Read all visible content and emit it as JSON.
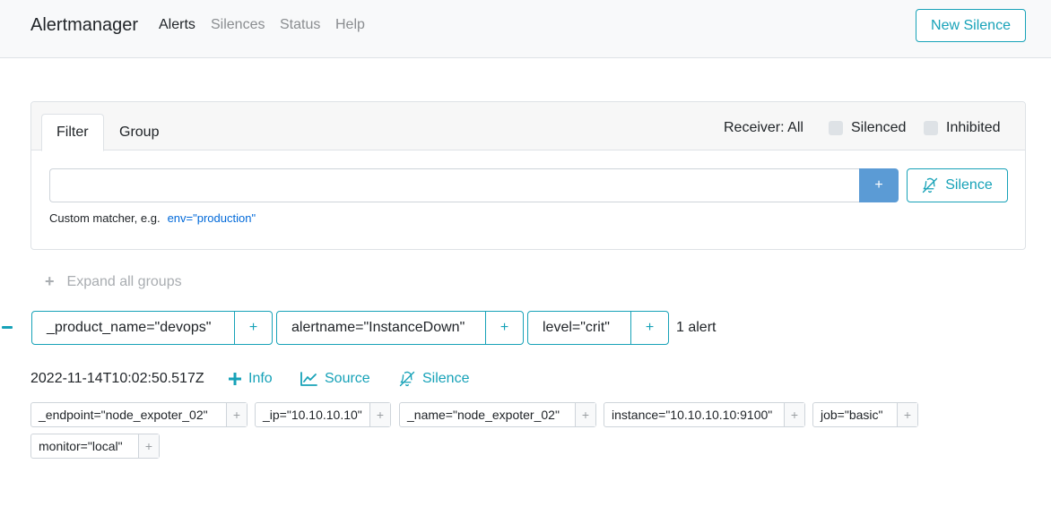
{
  "navbar": {
    "brand": "Alertmanager",
    "links": [
      "Alerts",
      "Silences",
      "Status",
      "Help"
    ],
    "active_link": "Alerts",
    "new_silence_label": "New Silence"
  },
  "filter_panel": {
    "tabs": [
      "Filter",
      "Group"
    ],
    "active_tab": "Filter",
    "receiver_label": "Receiver: All",
    "checkboxes": [
      {
        "label": "Silenced",
        "checked": false
      },
      {
        "label": "Inhibited",
        "checked": false
      }
    ],
    "input_value": "",
    "add_button_label": "+",
    "silence_button_label": "Silence",
    "hint_text": "Custom matcher, e.g.",
    "hint_example": "env=\"production\""
  },
  "expand_all_label": "Expand all groups",
  "group": {
    "labels": [
      {
        "text": "_product_name=\"devops\"",
        "add": "+"
      },
      {
        "text": "alertname=\"InstanceDown\"",
        "add": "+"
      },
      {
        "text": "level=\"crit\"",
        "add": "+"
      }
    ],
    "count_label": "1 alert"
  },
  "alert": {
    "timestamp": "2022-11-14T10:02:50.517Z",
    "actions": {
      "info": "Info",
      "source": "Source",
      "silence": "Silence"
    },
    "labels": [
      {
        "text": "_endpoint=\"node_expoter_02\"",
        "add": "+"
      },
      {
        "text": "_ip=\"10.10.10.10\"",
        "add": "+"
      },
      {
        "text": "_name=\"node_expoter_02\"",
        "add": "+"
      },
      {
        "text": "instance=\"10.10.10.10:9100\"",
        "add": "+"
      },
      {
        "text": "job=\"basic\"",
        "add": "+"
      },
      {
        "text": "monitor=\"local\"",
        "add": "+"
      }
    ]
  },
  "colors": {
    "accent": "#17a2b8",
    "primary_button": "#5b9bd5",
    "muted": "#a9adb1",
    "link": "#0069d9"
  }
}
